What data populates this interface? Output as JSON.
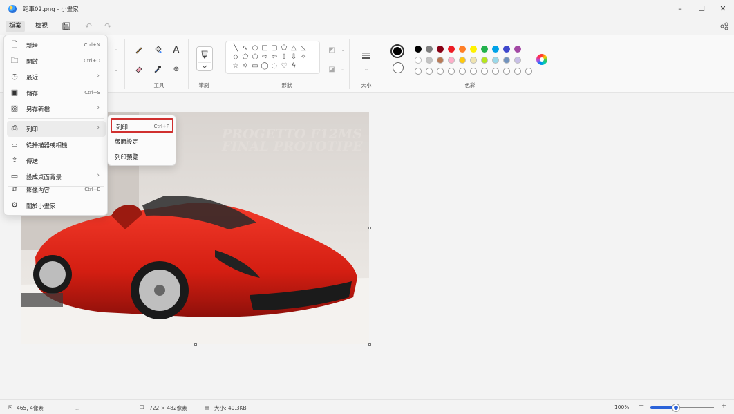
{
  "window": {
    "title": "跑車02.png - 小畫家"
  },
  "menubar": {
    "file": "檔案",
    "view": "檢視"
  },
  "ribbon": {
    "groups": {
      "tools": "工具",
      "brushes": "筆刷",
      "shapes": "形狀",
      "size": "大小",
      "colors": "色彩"
    },
    "text_tool": "A"
  },
  "colors": {
    "primary": "#000000",
    "secondary": "#ffffff",
    "palette_row1": [
      "#000000",
      "#7f7f7f",
      "#880015",
      "#ed1c24",
      "#ff7f27",
      "#fff200",
      "#22b14c",
      "#00a2e8",
      "#3f48cc",
      "#a349a4"
    ],
    "palette_row2": [
      "#ffffff",
      "#c3c3c3",
      "#b97a57",
      "#ffaec9",
      "#ffc90e",
      "#efe4b0",
      "#b5e61d",
      "#99d9ea",
      "#7092be",
      "#c8bfe7"
    ]
  },
  "file_menu": {
    "items": [
      {
        "label": "新增",
        "shortcut": "Ctrl+N",
        "icon": "new-file-icon"
      },
      {
        "label": "開啟",
        "shortcut": "Ctrl+O",
        "icon": "folder-icon"
      },
      {
        "label": "最近",
        "shortcut": "",
        "icon": "clock-icon"
      },
      {
        "label": "儲存",
        "shortcut": "Ctrl+S",
        "icon": "save-icon"
      },
      {
        "label": "另存新檔",
        "shortcut": "",
        "icon": "save-as-icon"
      },
      {
        "label": "列印",
        "shortcut": "",
        "icon": "printer-icon"
      },
      {
        "label": "從掃描器或相機",
        "shortcut": "",
        "icon": "scanner-icon"
      },
      {
        "label": "傳送",
        "shortcut": "",
        "icon": "share-icon"
      },
      {
        "label": "設成桌面背景",
        "shortcut": "",
        "icon": "desktop-icon"
      },
      {
        "label": "影像內容",
        "shortcut": "Ctrl+E",
        "icon": "image-properties-icon"
      },
      {
        "label": "關於小畫家",
        "shortcut": "",
        "icon": "gear-icon"
      }
    ]
  },
  "print_submenu": {
    "items": [
      {
        "label": "列印",
        "shortcut": "Ctrl+P"
      },
      {
        "label": "版面設定",
        "shortcut": ""
      },
      {
        "label": "列印預覽",
        "shortcut": ""
      }
    ]
  },
  "image_text": {
    "line1": "PROGETTO F12MS",
    "line2": "FINAL PROTOTIPE"
  },
  "status": {
    "cursor": "465, 4像素",
    "image_size": "722 × 482像素",
    "file_size": "大小: 40.3KB",
    "zoom": "100%",
    "zoom_fraction": 0.4
  }
}
